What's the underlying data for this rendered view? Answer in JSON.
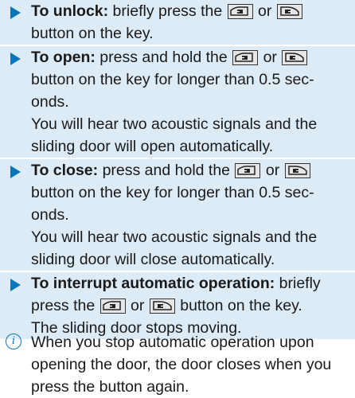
{
  "steps": [
    {
      "lines": [
        {
          "bold": "To unlock:",
          "a": " briefly press the ",
          "b": " or ",
          "c": ""
        },
        {
          "text": "button on the key."
        }
      ]
    },
    {
      "lines": [
        {
          "bold": "To open:",
          "a": " press and hold the ",
          "b": " or ",
          "c": ""
        },
        {
          "text": "button on the key for longer than 0.5 sec-"
        },
        {
          "text": "onds."
        },
        {
          "text": "You will hear two acoustic signals and the"
        },
        {
          "text": "sliding door will open automatically."
        }
      ]
    },
    {
      "lines": [
        {
          "bold": "To close:",
          "a": " press and hold the ",
          "b": " or ",
          "c": ""
        },
        {
          "text": "button on the key for longer than 0.5 sec-"
        },
        {
          "text": "onds."
        },
        {
          "text": "You will hear two acoustic signals and the"
        },
        {
          "text": "sliding door will close automatically."
        }
      ]
    },
    {
      "lines": [
        {
          "bold": "To interrupt automatic operation:",
          "a": " briefly"
        },
        {
          "a": "press the ",
          "b": " or ",
          "c": " button on the key."
        },
        {
          "text": "The sliding door stops moving."
        }
      ]
    }
  ],
  "info": {
    "icon": "info-icon",
    "glyph": "i",
    "lines": [
      "When you stop automatic operation upon",
      "opening the door, the door closes when you",
      "press the button again."
    ]
  },
  "colors": {
    "accent": "#0a76bb",
    "highlight": "#dcebf6"
  }
}
